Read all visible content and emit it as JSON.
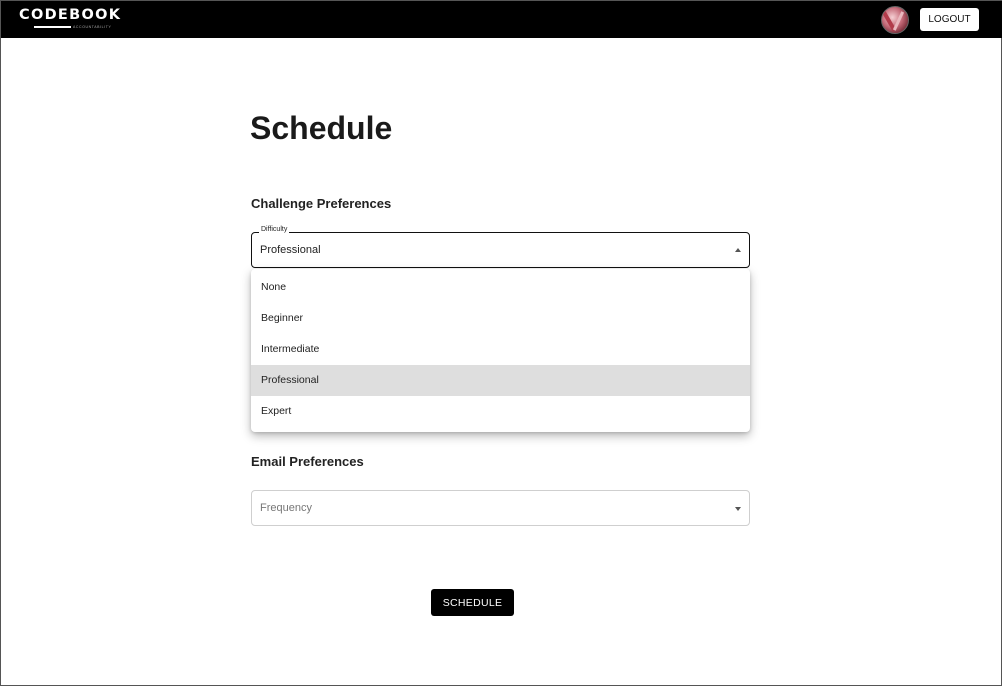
{
  "app": {
    "logo_text": "CODEBOOK",
    "logo_subtext": "ACCOUNTABILITY",
    "logout_label": "LOGOUT"
  },
  "page": {
    "title": "Schedule"
  },
  "challenge": {
    "section_title": "Challenge Preferences",
    "difficulty": {
      "label": "Difficulty",
      "value": "Professional",
      "options": [
        "None",
        "Beginner",
        "Intermediate",
        "Professional",
        "Expert"
      ],
      "selected_index": 3
    }
  },
  "email": {
    "section_title": "Email Preferences",
    "frequency": {
      "placeholder": "Frequency"
    }
  },
  "actions": {
    "schedule_label": "SCHEDULE"
  },
  "colors": {
    "navbar": "#000000",
    "selected_option": "#dedede",
    "primary_button": "#000000"
  }
}
